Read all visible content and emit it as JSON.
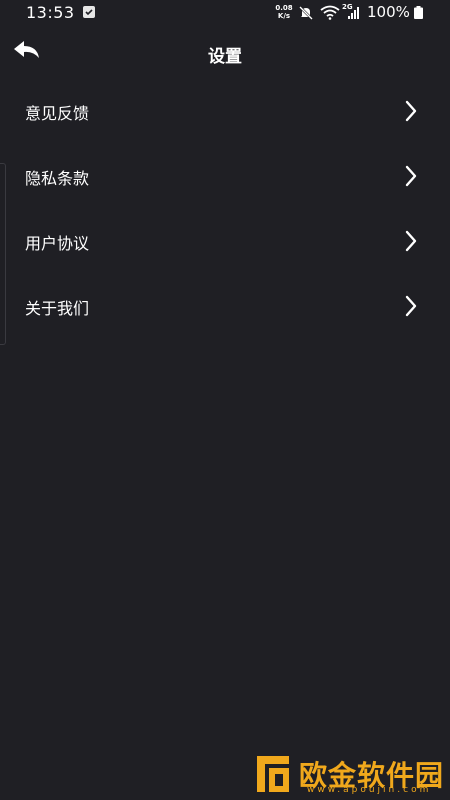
{
  "status_bar": {
    "time": "13:53",
    "net_speed_value": "0.08",
    "net_speed_unit": "K/s",
    "signal_type": "2G",
    "battery": "100%",
    "icons": [
      "mail-check-icon",
      "mute-icon",
      "wifi-icon",
      "signal-icon",
      "battery-icon"
    ]
  },
  "header": {
    "title": "设置",
    "back_icon": "back-arrow-icon"
  },
  "menu": {
    "items": [
      {
        "label": "意见反馈",
        "icon": "chevron-right-icon"
      },
      {
        "label": "隐私条款",
        "icon": "chevron-right-icon"
      },
      {
        "label": "用户协议",
        "icon": "chevron-right-icon"
      },
      {
        "label": "关于我们",
        "icon": "chevron-right-icon"
      }
    ]
  },
  "watermark": {
    "text": "欧金软件园",
    "url": "www.apoujin.com"
  },
  "colors": {
    "background": "#1f1f24",
    "text": "#ffffff",
    "watermark": "#f0a81c"
  }
}
